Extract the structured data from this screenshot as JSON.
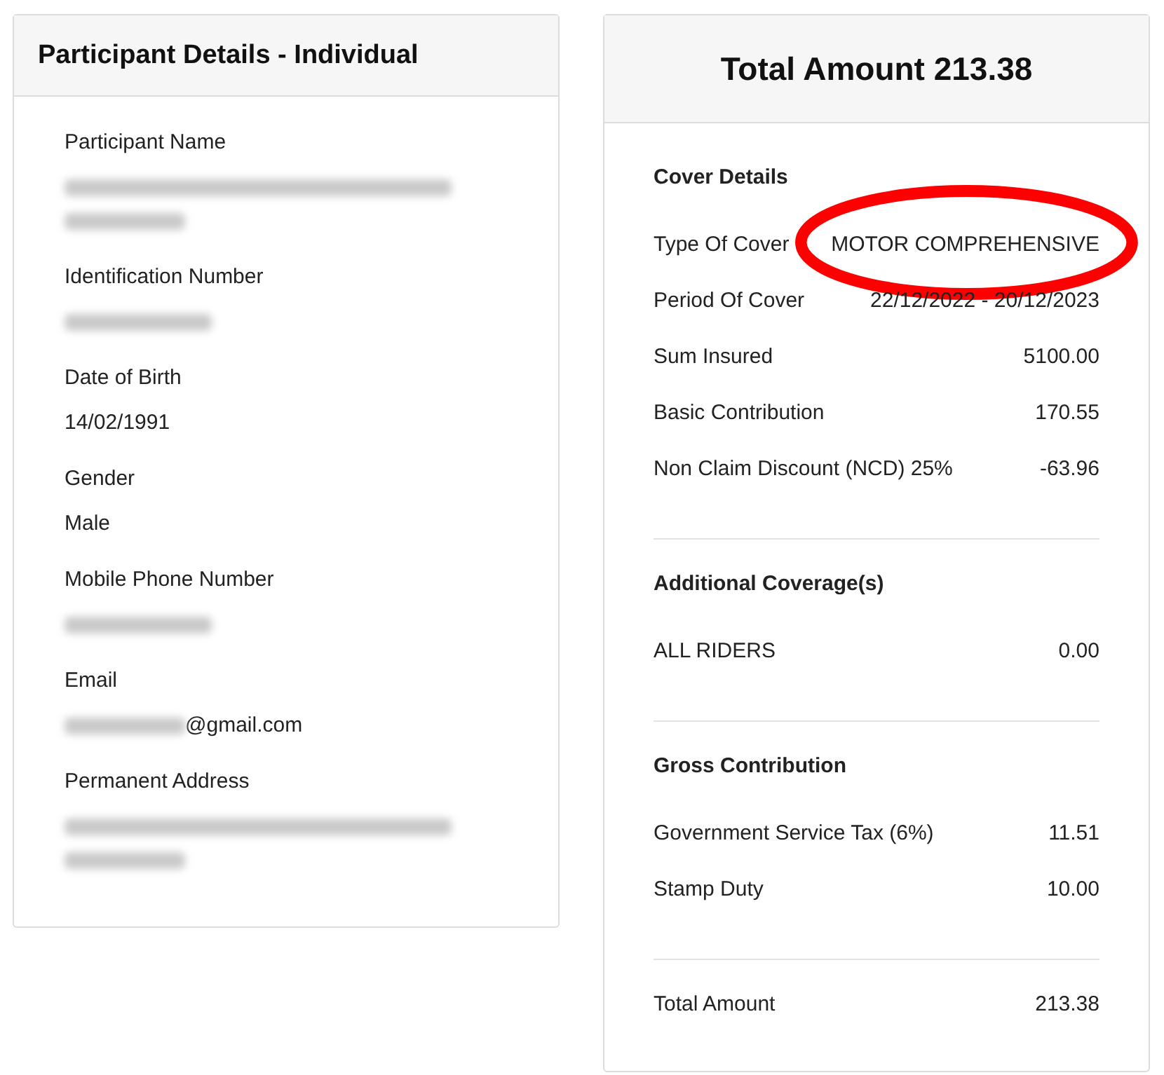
{
  "participant": {
    "title": "Participant Details - Individual",
    "fields": [
      {
        "label": "Participant Name",
        "lines": [
          [
            {
              "kind": "redacted_long"
            }
          ],
          [
            {
              "kind": "redacted_short"
            }
          ]
        ]
      },
      {
        "label": "Identification Number",
        "lines": [
          [
            {
              "kind": "redacted_medium"
            }
          ]
        ]
      },
      {
        "label": "Date of Birth",
        "lines": [
          [
            {
              "kind": "text",
              "text": "14/02/1991"
            }
          ]
        ]
      },
      {
        "label": "Gender",
        "lines": [
          [
            {
              "kind": "text",
              "text": "Male"
            }
          ]
        ]
      },
      {
        "label": "Mobile Phone Number",
        "lines": [
          [
            {
              "kind": "redacted_medium"
            }
          ]
        ]
      },
      {
        "label": "Email",
        "lines": [
          [
            {
              "kind": "redacted_short"
            },
            {
              "kind": "text",
              "text": "@gmail.com"
            }
          ]
        ]
      },
      {
        "label": "Permanent Address",
        "lines": [
          [
            {
              "kind": "redacted_long"
            }
          ],
          [
            {
              "kind": "redacted_short"
            }
          ]
        ]
      }
    ]
  },
  "summary": {
    "title": "Total Amount 213.38",
    "sections": [
      {
        "heading": "Cover Details",
        "rows": [
          {
            "label": "Type Of Cover",
            "value": "MOTOR COMPREHENSIVE",
            "highlighted": true
          },
          {
            "label": "Period Of Cover",
            "value": "22/12/2022 - 20/12/2023",
            "highlighted": false
          },
          {
            "label": "Sum Insured",
            "value": "5100.00",
            "highlighted": false
          },
          {
            "label": "Basic Contribution",
            "value": "170.55",
            "highlighted": false
          },
          {
            "label": "Non Claim Discount (NCD) 25%",
            "value": "-63.96",
            "highlighted": false
          }
        ]
      },
      {
        "heading": "Additional Coverage(s)",
        "rows": [
          {
            "label": "ALL RIDERS",
            "value": "0.00",
            "highlighted": false
          }
        ]
      },
      {
        "heading": "Gross Contribution",
        "rows": [
          {
            "label": "Government Service Tax (6%)",
            "value": "11.51",
            "highlighted": false
          },
          {
            "label": "Stamp Duty",
            "value": "10.00",
            "highlighted": false
          }
        ]
      },
      {
        "rows": [
          {
            "label": "Total Amount",
            "value": "213.38",
            "highlighted": false
          }
        ]
      }
    ]
  }
}
